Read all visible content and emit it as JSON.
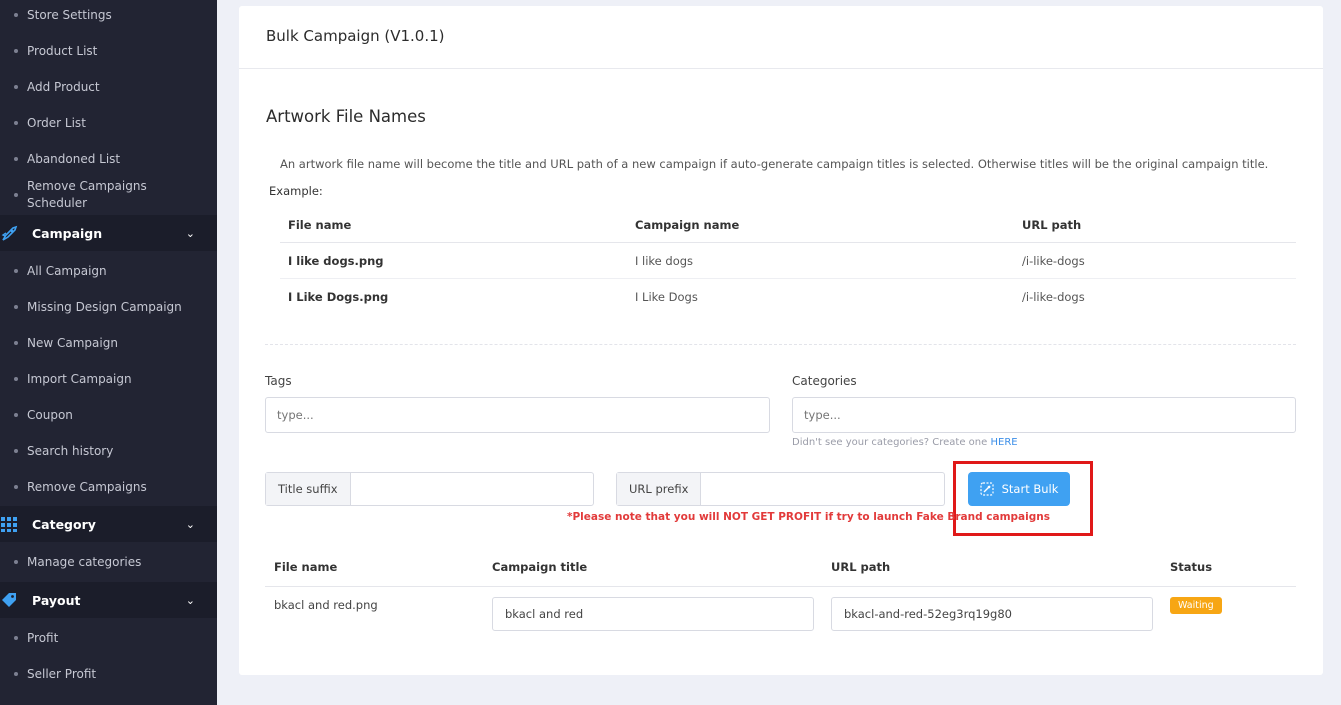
{
  "sidebar": {
    "top_items": [
      {
        "label": "Store Settings"
      },
      {
        "label": "Product List"
      },
      {
        "label": "Add Product"
      },
      {
        "label": "Order List"
      },
      {
        "label": "Abandoned List"
      },
      {
        "label": "Remove Campaigns Scheduler"
      }
    ],
    "campaign_group": {
      "label": "Campaign",
      "icon": "rocket-icon"
    },
    "campaign_items": [
      {
        "label": "All Campaign"
      },
      {
        "label": "Missing Design Campaign"
      },
      {
        "label": "New Campaign"
      },
      {
        "label": "Import Campaign"
      },
      {
        "label": "Coupon"
      },
      {
        "label": "Search history"
      },
      {
        "label": "Remove Campaigns"
      }
    ],
    "category_group": {
      "label": "Category",
      "icon": "grid-icon"
    },
    "category_items": [
      {
        "label": "Manage categories"
      }
    ],
    "payout_group": {
      "label": "Payout",
      "icon": "tag-icon"
    },
    "payout_items": [
      {
        "label": "Profit"
      },
      {
        "label": "Seller Profit"
      }
    ]
  },
  "card": {
    "title": "Bulk Campaign (V1.0.1)",
    "section_title": "Artwork File Names",
    "description": "An artwork file name will become the title and URL path of a new campaign if auto-generate campaign titles is selected. Otherwise titles will be the original campaign title.",
    "example_label": "Example:",
    "example_table": {
      "headers": [
        "File name",
        "Campaign name",
        "URL path"
      ],
      "rows": [
        [
          "I like dogs.png",
          "I like dogs",
          "/i-like-dogs"
        ],
        [
          "I Like Dogs.png",
          "I Like Dogs",
          "/i-like-dogs"
        ]
      ]
    },
    "tags": {
      "label": "Tags",
      "placeholder": "type..."
    },
    "categories": {
      "label": "Categories",
      "placeholder": "type...",
      "help_text": "Didn't see your categories? Create one",
      "help_link": "HERE"
    },
    "title_suffix": {
      "label": "Title suffix",
      "value": ""
    },
    "url_prefix": {
      "label": "URL prefix",
      "value": ""
    },
    "start_button": {
      "label": "Start Bulk",
      "color": "#3fa1f2"
    },
    "highlight_color": "#e01818",
    "warning": "*Please note that you will NOT GET PROFIT if try to launch Fake Brand campaigns",
    "results_table": {
      "headers": [
        "File name",
        "Campaign title",
        "URL path",
        "Status"
      ],
      "rows": [
        {
          "file": "bkacl and red.png",
          "title": "bkacl and red",
          "url": "bkacl-and-red-52eg3rq19g80",
          "status": "Waiting",
          "status_color": "#f7a614"
        }
      ]
    }
  }
}
